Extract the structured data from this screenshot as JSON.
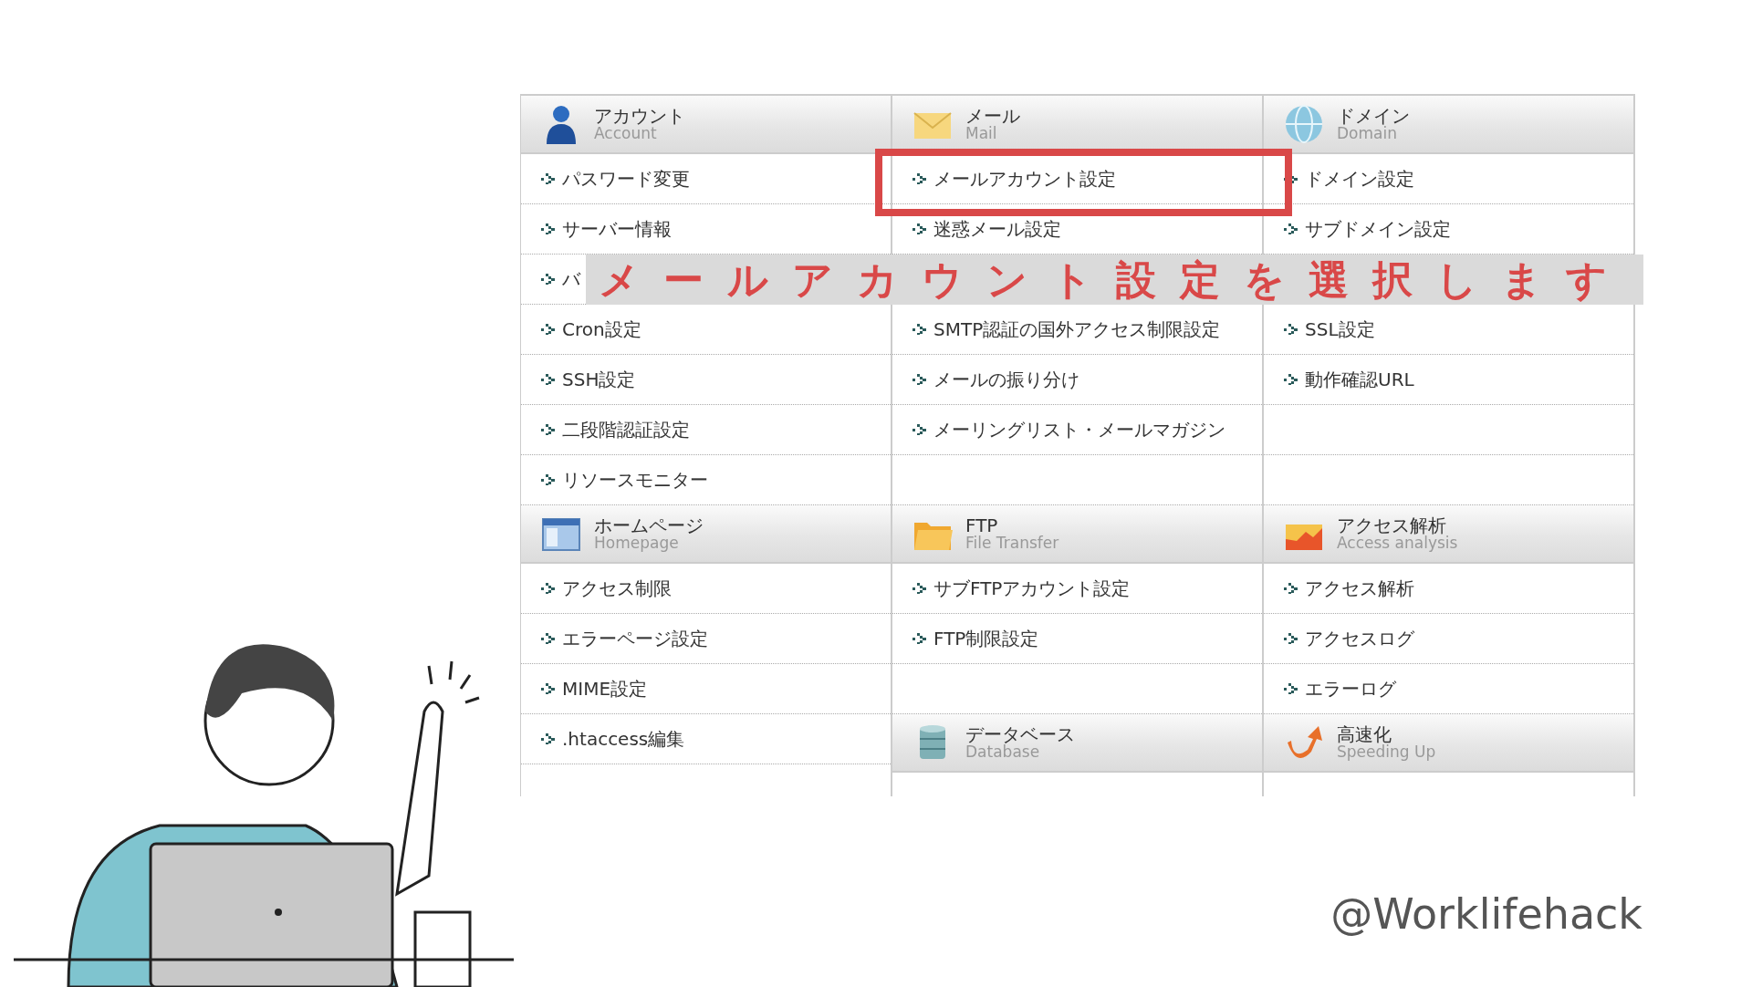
{
  "columns": [
    {
      "sections": [
        {
          "title": "アカウント",
          "subtitle": "Account",
          "items": [
            {
              "kind": "link",
              "label": "パスワード変更",
              "highlighted": false
            },
            {
              "kind": "link",
              "label": "サーバー情報",
              "highlighted": false
            },
            {
              "kind": "link",
              "label": "バ",
              "highlighted": false
            },
            {
              "kind": "link",
              "label": "Cron設定",
              "highlighted": false
            },
            {
              "kind": "link",
              "label": "SSH設定",
              "highlighted": false
            },
            {
              "kind": "link",
              "label": "二段階認証設定",
              "highlighted": false
            },
            {
              "kind": "link",
              "label": "リソースモニター",
              "highlighted": false
            }
          ]
        },
        {
          "title": "ホームページ",
          "subtitle": "Homepage",
          "items": [
            {
              "kind": "link",
              "label": "アクセス制限",
              "highlighted": false
            },
            {
              "kind": "link",
              "label": "エラーページ設定",
              "highlighted": false
            },
            {
              "kind": "link",
              "label": "MIME設定",
              "highlighted": false
            },
            {
              "kind": "link",
              "label": ".htaccess編集",
              "highlighted": false
            }
          ]
        }
      ]
    },
    {
      "sections": [
        {
          "title": "メール",
          "subtitle": "Mail",
          "items": [
            {
              "kind": "link",
              "label": "メールアカウント設定",
              "highlighted": true
            },
            {
              "kind": "link",
              "label": "迷惑メール設定",
              "highlighted": false
            },
            {
              "kind": "gap"
            },
            {
              "kind": "link",
              "label": "SMTP認証の国外アクセス制限設定",
              "highlighted": false
            },
            {
              "kind": "link",
              "label": "メールの振り分け",
              "highlighted": false
            },
            {
              "kind": "link",
              "label": "メーリングリスト・メールマガジン",
              "highlighted": false
            }
          ]
        },
        {
          "title": "FTP",
          "subtitle": "File Transfer",
          "items": [
            {
              "kind": "link",
              "label": "サブFTPアカウント設定",
              "highlighted": false
            },
            {
              "kind": "link",
              "label": "FTP制限設定",
              "highlighted": false
            }
          ]
        },
        {
          "title": "データベース",
          "subtitle": "Database"
        }
      ]
    },
    {
      "sections": [
        {
          "title": "ドメイン",
          "subtitle": "Domain",
          "items": [
            {
              "kind": "link",
              "label": "ドメイン設定",
              "highlighted": false
            },
            {
              "kind": "link",
              "label": "サブドメイン設定",
              "highlighted": false
            },
            {
              "kind": "gap"
            },
            {
              "kind": "link",
              "label": "SSL設定",
              "highlighted": false
            },
            {
              "kind": "link",
              "label": "動作確認URL",
              "highlighted": false
            }
          ]
        },
        {
          "title": "アクセス解析",
          "subtitle": "Access analysis",
          "items": [
            {
              "kind": "link",
              "label": "アクセス解析",
              "highlighted": false
            },
            {
              "kind": "link",
              "label": "アクセスログ",
              "highlighted": false
            },
            {
              "kind": "link",
              "label": "エラーログ",
              "highlighted": false
            }
          ]
        },
        {
          "title": "高速化",
          "subtitle": "Speeding Up"
        }
      ]
    }
  ],
  "caption": "メールアカウント設定を選択します",
  "handle": "@Worklifehack"
}
